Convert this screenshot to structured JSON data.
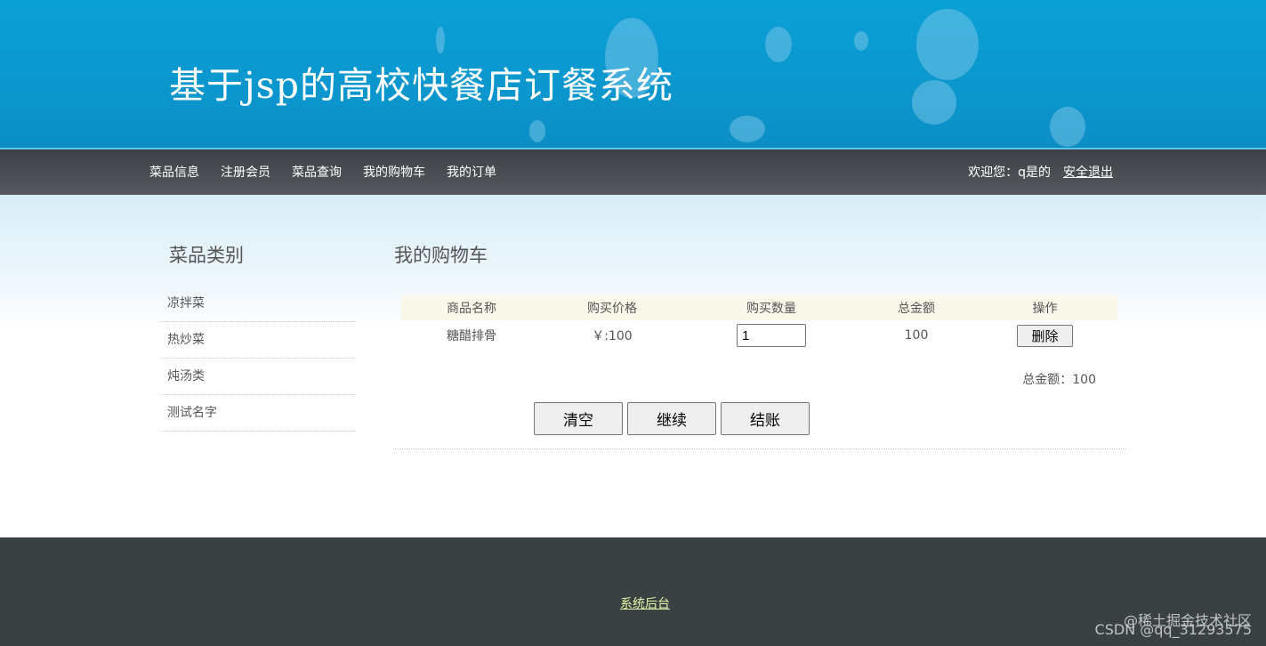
{
  "header": {
    "title": "基于jsp的高校快餐店订餐系统"
  },
  "nav": {
    "items": [
      {
        "label": "菜品信息"
      },
      {
        "label": "注册会员"
      },
      {
        "label": "菜品查询"
      },
      {
        "label": "我的购物车"
      },
      {
        "label": "我的订单"
      }
    ],
    "welcome": "欢迎您：q是的",
    "logout": "安全退出"
  },
  "sidebar": {
    "title": "菜品类别",
    "categories": [
      {
        "label": "凉拌菜"
      },
      {
        "label": "热炒菜"
      },
      {
        "label": "炖汤类"
      },
      {
        "label": "测试名字"
      }
    ]
  },
  "cart": {
    "title": "我的购物车",
    "columns": [
      "商品名称",
      "购买价格",
      "购买数量",
      "总金额",
      "操作"
    ],
    "rows": [
      {
        "name": "糖醋排骨",
        "price": "￥:100",
        "quantity": "1",
        "subtotal": "100",
        "action": "删除"
      }
    ],
    "total_label": "总金额：100",
    "buttons": {
      "clear": "清空",
      "continue": "继续",
      "checkout": "结账"
    }
  },
  "footer": {
    "link": "系统后台",
    "watermark_1": "@稀土掘金技术社区",
    "watermark_2": "CSDN @qq_31293575"
  },
  "colors": {
    "banner": "#0b95cc",
    "navbar": "#4a4e53",
    "footer": "#3b4143",
    "footer_link": "#e4f7a8"
  }
}
